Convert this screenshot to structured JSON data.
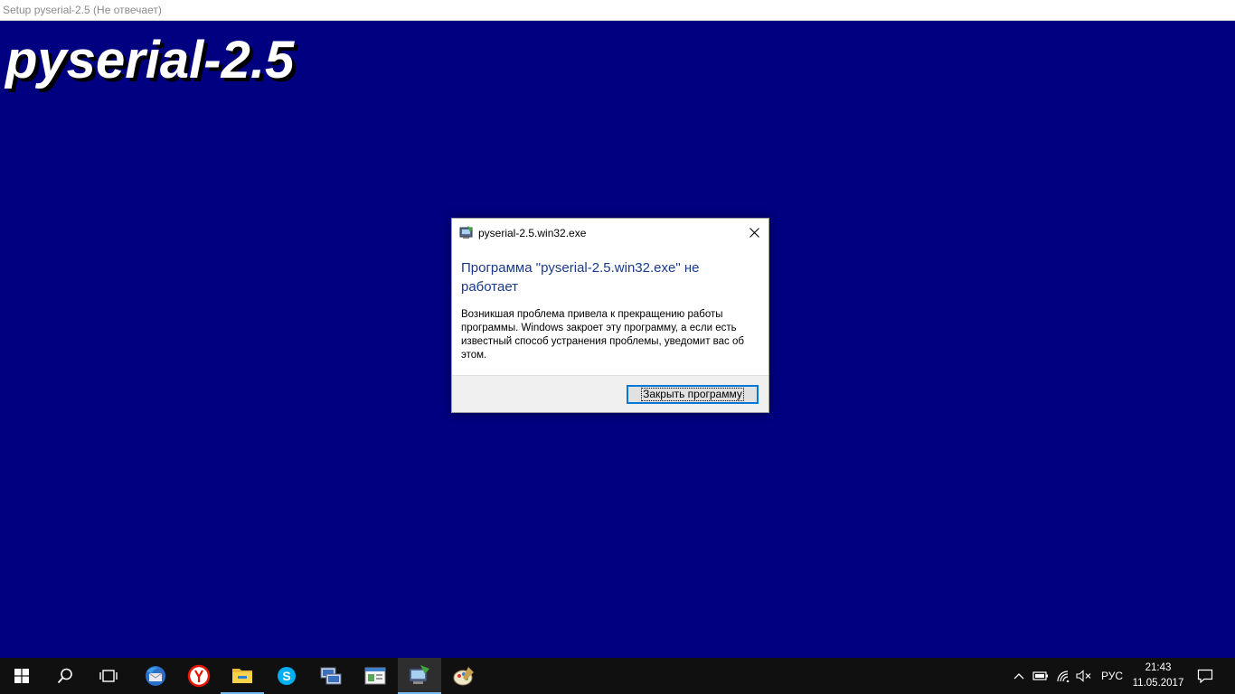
{
  "setup_window": {
    "title": "Setup pyserial-2.5 (Не отвечает)",
    "heading": "pyserial-2.5",
    "background_color": "#000080"
  },
  "dialog": {
    "title": "pyserial-2.5.win32.exe",
    "app_icon": "installer-icon",
    "heading": "Программа \"pyserial-2.5.win32.exe\" не работает",
    "message": "Возникшая проблема привела к прекращению работы программы. Windows закроет эту программу, а если есть известный способ устранения проблемы, уведомит вас об этом.",
    "close_button_label": "Закрыть программу",
    "heading_color": "#1a3a8a",
    "accent_color": "#0078d7"
  },
  "taskbar": {
    "items": [
      {
        "name": "start-icon"
      },
      {
        "name": "search-icon"
      },
      {
        "name": "task-view-icon"
      },
      {
        "name": "thunderbird-icon"
      },
      {
        "name": "yandex-browser-icon"
      },
      {
        "name": "file-explorer-icon"
      },
      {
        "name": "skype-icon"
      },
      {
        "name": "network-connections-icon"
      },
      {
        "name": "app-window-icon"
      },
      {
        "name": "installer-icon",
        "active": true
      },
      {
        "name": "paint-icon"
      }
    ],
    "tray": {
      "language": "РУС",
      "time": "21:43",
      "date": "11.05.2017",
      "icons": [
        "chevron-up-icon",
        "battery-icon",
        "wifi-icon",
        "volume-muted-icon",
        "notification-icon"
      ]
    },
    "background_color": "#101010",
    "active_indicator_color": "#76b9ed"
  }
}
